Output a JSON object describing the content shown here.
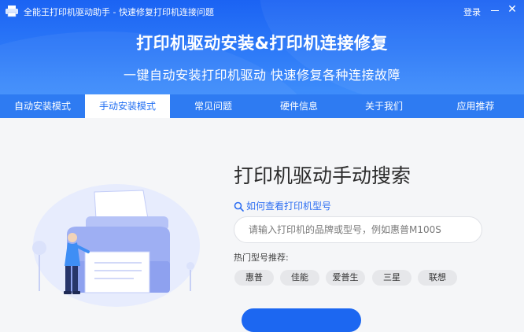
{
  "window": {
    "title": "全能王打印机驱动助手 - 快速修复打印机连接问题",
    "login_label": "登录",
    "close_glyph": "✕"
  },
  "hero": {
    "title": "打印机驱动安装&打印机连接修复",
    "subtitle": "一键自动安装打印机驱动 快速修复各种连接故障"
  },
  "nav": {
    "items": [
      {
        "label": "自动安装模式",
        "active": false
      },
      {
        "label": "手动安装模式",
        "active": true
      },
      {
        "label": "常见问题",
        "active": false
      },
      {
        "label": "硬件信息",
        "active": false
      },
      {
        "label": "关于我们",
        "active": false
      },
      {
        "label": "应用推荐",
        "active": false
      }
    ]
  },
  "manual": {
    "title": "打印机驱动手动搜索",
    "howto_link": "如何查看打印机型号",
    "search_placeholder": "请输入打印机的品牌或型号，例如惠普M100S",
    "hot_label": "热门型号推荐:",
    "hot_models": [
      "惠普",
      "佳能",
      "爱普生",
      "三星",
      "联想"
    ]
  },
  "colors": {
    "brand": "#1c67f1",
    "header": "#2f7cf8",
    "nav": "#2e7bf2"
  }
}
